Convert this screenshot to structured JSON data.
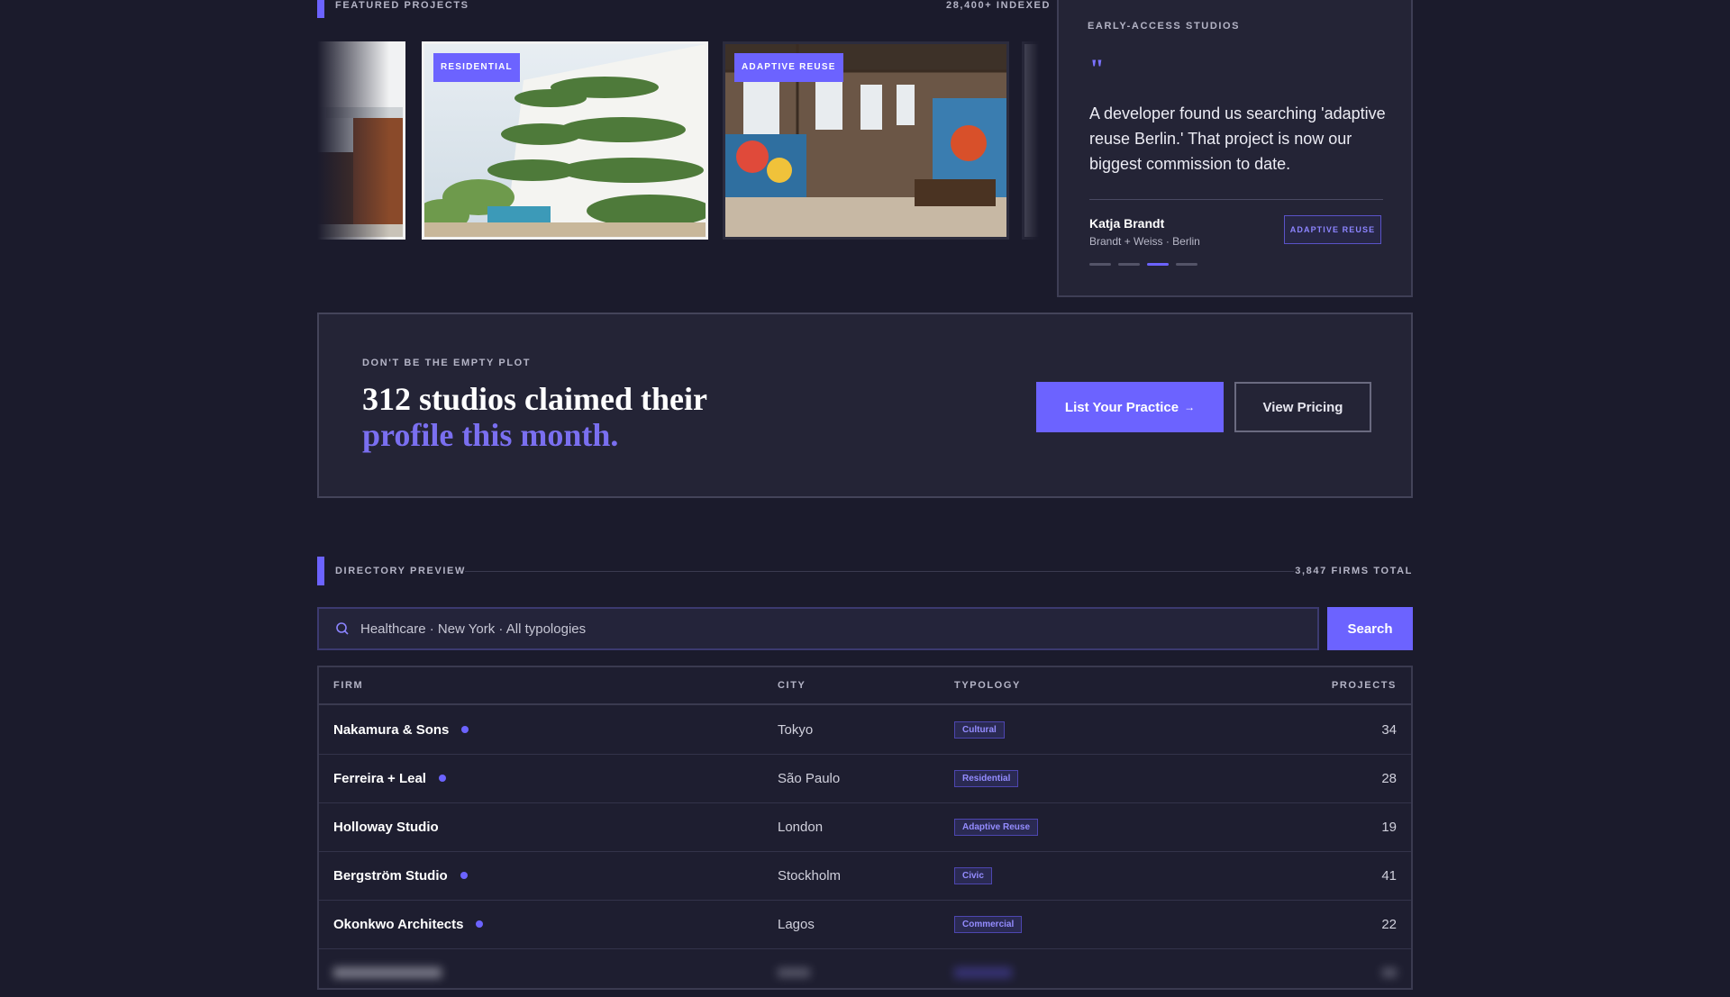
{
  "featured": {
    "heading": "FEATURED PROJECTS",
    "count": "28,400+ INDEXED",
    "cards": [
      {
        "badge": ""
      },
      {
        "badge": "RESIDENTIAL"
      },
      {
        "badge": "ADAPTIVE REUSE"
      }
    ]
  },
  "testimonial": {
    "heading": "EARLY-ACCESS STUDIOS",
    "quote_mark": "\"",
    "quote": "A developer found us searching 'adaptive reuse Berlin.' That project is now our biggest commission to date.",
    "name": "Katja Brandt",
    "firm": "Brandt + Weiss · Berlin",
    "tag": "ADAPTIVE REUSE",
    "active_dot": 3,
    "dot_count": 4
  },
  "cta": {
    "kicker": "DON'T BE THE EMPTY PLOT",
    "headline_line1": "312 studios claimed their",
    "headline_line2": "profile this month.",
    "primary_button": "List Your Practice",
    "primary_arrow": "→",
    "secondary_button": "View Pricing"
  },
  "directory": {
    "heading": "DIRECTORY PREVIEW",
    "total": "3,847 FIRMS TOTAL",
    "search_placeholder": "Healthcare · New York · All typologies",
    "search_button": "Search",
    "columns": {
      "firm": "FIRM",
      "city": "CITY",
      "typology": "TYPOLOGY",
      "projects": "PROJECTS"
    },
    "rows": [
      {
        "firm": "Nakamura & Sons",
        "verified": true,
        "city": "Tokyo",
        "typology": "Cultural",
        "projects": "34"
      },
      {
        "firm": "Ferreira + Leal",
        "verified": true,
        "city": "São Paulo",
        "typology": "Residential",
        "projects": "28"
      },
      {
        "firm": "Holloway Studio",
        "verified": false,
        "city": "London",
        "typology": "Adaptive Reuse",
        "projects": "19"
      },
      {
        "firm": "Bergström Studio",
        "verified": true,
        "city": "Stockholm",
        "typology": "Civic",
        "projects": "41"
      },
      {
        "firm": "Okonkwo Architects",
        "verified": true,
        "city": "Lagos",
        "typology": "Commercial",
        "projects": "22"
      }
    ]
  },
  "colors": {
    "accent": "#6c63ff",
    "background": "#1b1b2c",
    "panel": "#242436"
  }
}
